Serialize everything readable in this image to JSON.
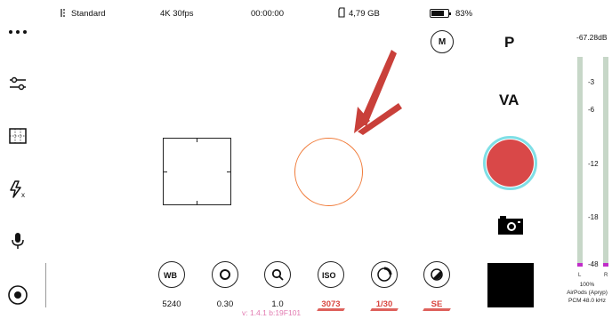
{
  "status": {
    "stabilization_label": "Standard",
    "resolution": "4K 30fps",
    "timecode": "00:00:00",
    "storage": "4,79 GB",
    "battery": "83%",
    "battery_level": 0.83
  },
  "sidebar": {
    "items": [
      {
        "icon": "more-dots-icon"
      },
      {
        "icon": "settings-sliders-icon"
      },
      {
        "icon": "grid-frame-icon"
      },
      {
        "icon": "flash-off-icon"
      },
      {
        "icon": "microphone-icon"
      },
      {
        "icon": "target-icon"
      }
    ]
  },
  "controls": [
    {
      "icon": "white-balance-icon",
      "value": "5240",
      "highlight": false
    },
    {
      "icon": "tint-icon",
      "value": "0.30",
      "highlight": false
    },
    {
      "icon": "zoom-icon",
      "value": "1.0",
      "highlight": false
    },
    {
      "icon": "iso-icon",
      "value": "3073",
      "highlight": true
    },
    {
      "icon": "shutter-icon",
      "value": "1/30",
      "highlight": true
    },
    {
      "icon": "exposure-icon",
      "value": "SE",
      "highlight": true
    }
  ],
  "version": "v: 1.4.1 b:19F101",
  "right": {
    "manual_label": "M",
    "mode_p": "P",
    "mode_va": "VA"
  },
  "audio": {
    "peak": "-67.28dB",
    "ticks": [
      "-3",
      "-6",
      "-12",
      "-18",
      "-48"
    ],
    "left": "L",
    "right": "R",
    "level": "100%",
    "device": "AirPods (Apryp)",
    "format": "PCM 48.0 kHz"
  },
  "colors": {
    "record": "#d94848",
    "record_ring": "#7fdfe6",
    "exposure_circle": "#f07a38",
    "highlight_value": "#d8453f",
    "version_text": "#e27bb1",
    "meter_bar": "#c7d7c8",
    "meter_peak": "#c02dc9",
    "annotation_arrow": "#c9403a"
  }
}
